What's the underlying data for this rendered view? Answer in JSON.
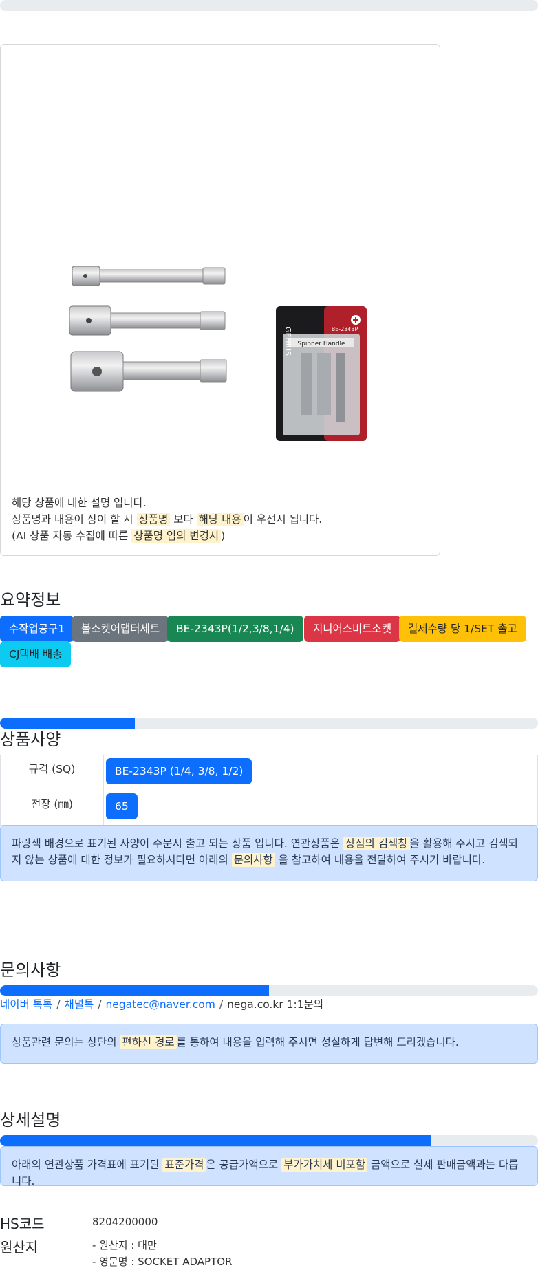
{
  "top_progress": 0,
  "description": {
    "line1": "해당 상품에 대한 설명 입니다.",
    "line2_a": "상품명과 내용이 상이 할 시 ",
    "line2_hl1": "상품명",
    "line2_b": " 보다 ",
    "line2_hl2": "해당 내용",
    "line2_c": "이 우선시 됩니다.",
    "line3_a": "(AI 상품 자동 수집에 따른 ",
    "line3_hl": "상품명 임의 변경시",
    "line3_b": ")"
  },
  "product_image": {
    "packaging_brand": "GENIUS",
    "packaging_model": "BE-2343P",
    "packaging_label": "Spinner Handle"
  },
  "summary": {
    "title": "요약정보",
    "badges": [
      {
        "label": "수작업공구1",
        "color": "#0d6efd"
      },
      {
        "label": "볼소켓어댑터세트",
        "color": "#6c757d"
      },
      {
        "label": "BE-2343P(1/2,3/8,1/4)",
        "color": "#198754"
      },
      {
        "label": "지니어스비트소켓",
        "color": "#dc3545"
      },
      {
        "label": "결제수량 당 1/SET 출고",
        "color": "#ffc107"
      },
      {
        "label": "CJ택배 배송",
        "color": "#0dcaf0"
      }
    ]
  },
  "specs": {
    "title": "상품사양",
    "progress": 25,
    "rows": [
      {
        "key": "규격 (SQ)",
        "value": "BE-2343P (1/4, 3/8, 1/2)"
      },
      {
        "key": "전장 (㎜)",
        "value": "65"
      }
    ],
    "note_a": "파랑색 배경으로 표기된 사양이 주문시 출고 되는 상품 입니다. 연관상품은 ",
    "note_hl1": "상점의 검색창",
    "note_b": "을 활용해 주시고 검색되지 않는 상품에 대한 정보가 필요하시다면 아래의 ",
    "note_hl2": "문의사항",
    "note_c": " 을 참고하여 내용을 전달하여 주시기 바랍니다."
  },
  "inquiry": {
    "title": "문의사항",
    "progress": 50,
    "links": [
      "네이버 톡톡",
      "채널톡",
      "negatec@naver.com"
    ],
    "plain": "nega.co.kr 1:1문의",
    "separator": "/",
    "note_a": "상품관련 문의는 상단의 ",
    "note_hl": "편하신 경로",
    "note_b": "를 통하여 내용을 입력해 주시면 성실하게 답변해 드리겠습니다."
  },
  "detail": {
    "title": "상세설명",
    "progress": 80,
    "note_a": "아래의 연관상품 가격표에 표기된 ",
    "note_hl1": "표준가격",
    "note_b": "은 공급가액으로 ",
    "note_hl2": "부가가치세 비포함",
    "note_c": " 금액으로 실제 판매금액과는 다릅니다."
  },
  "hs": {
    "key": "HS코드",
    "value": "8204200000"
  },
  "origin": {
    "key": "원산지",
    "line1": "- 원산지 : 대만",
    "line2": "- 영문명 : SOCKET ADAPTOR"
  }
}
